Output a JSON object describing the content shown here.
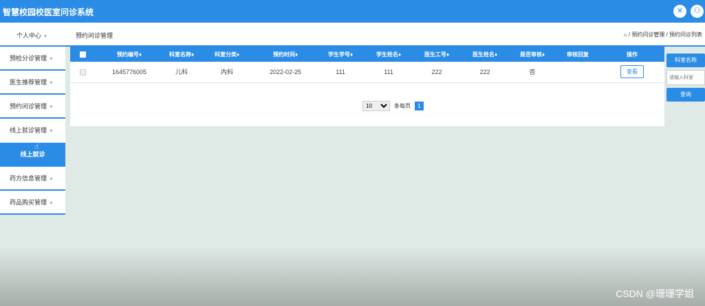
{
  "app": {
    "title": "智慧校园校医室问诊系统"
  },
  "topbar": {
    "icon1": "close-circle-icon",
    "icon2": "user-icon"
  },
  "header": {
    "user_center": "个人中心",
    "page_heading": "预约问诊管理",
    "breadcrumb": "⌂ / 预约问诊管理 / 预约问诊列表"
  },
  "sidebar": {
    "caret": "▼",
    "items": [
      {
        "label": "预检分诊管理"
      },
      {
        "label": "医生推荐管理"
      },
      {
        "label": "预约问诊管理"
      },
      {
        "label": "线上就诊管理"
      }
    ],
    "active_sub": "线上就诊",
    "items_after": [
      {
        "label": "药方信息管理"
      },
      {
        "label": "药品购买管理"
      }
    ]
  },
  "table": {
    "headers": [
      "预约编号♦",
      "科室名称♦",
      "科室分类♦",
      "预约时间♦",
      "学生学号♦",
      "学生姓名♦",
      "医生工号♦",
      "医生姓名♦",
      "是否审核♦",
      "审核回复",
      "操作"
    ],
    "rows": [
      {
        "cells": [
          "1645776005",
          "儿科",
          "内科",
          "2022-02-25",
          "111",
          "111",
          "222",
          "222",
          "否",
          ""
        ],
        "action": "查看"
      }
    ]
  },
  "pager": {
    "page_size": "10",
    "per_page_label": "条每页",
    "current_page": "1"
  },
  "search": {
    "label": "科室名称",
    "placeholder": "请输入科室",
    "button": "查询"
  },
  "watermark": "CSDN @珊珊学姐",
  "colors": {
    "primary": "#2b8ce6",
    "background": "#dfe9e5"
  }
}
